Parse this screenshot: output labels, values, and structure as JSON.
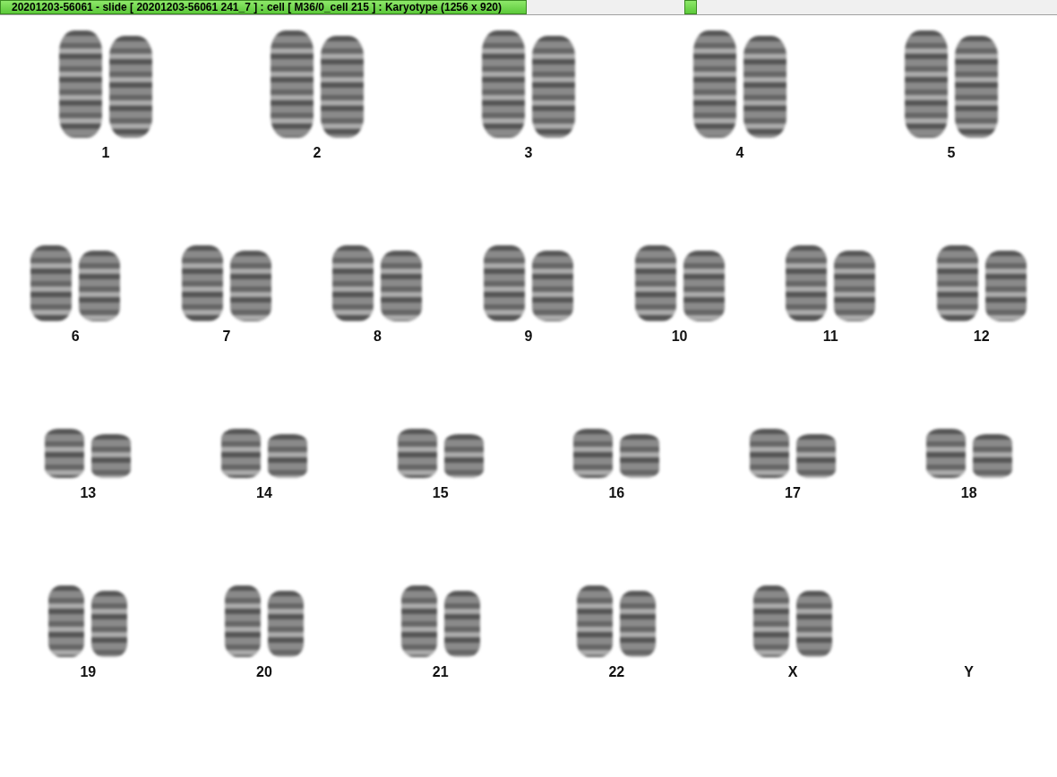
{
  "window": {
    "title": "20201203-56061 - slide [ 20201203-56061 241_7 ] : cell [ M36/0_cell 215 ] : Karyotype  (1256 x 920)"
  },
  "rows": [
    {
      "pairs": [
        {
          "label": "1",
          "kind": "pair"
        },
        {
          "label": "2",
          "kind": "pair"
        },
        {
          "label": "3",
          "kind": "pair"
        },
        {
          "label": "4",
          "kind": "pair"
        },
        {
          "label": "5",
          "kind": "pair"
        }
      ]
    },
    {
      "pairs": [
        {
          "label": "6",
          "kind": "pair"
        },
        {
          "label": "7",
          "kind": "pair"
        },
        {
          "label": "8",
          "kind": "pair"
        },
        {
          "label": "9",
          "kind": "pair"
        },
        {
          "label": "10",
          "kind": "pair"
        },
        {
          "label": "11",
          "kind": "pair"
        },
        {
          "label": "12",
          "kind": "pair"
        }
      ]
    },
    {
      "pairs": [
        {
          "label": "13",
          "kind": "pair"
        },
        {
          "label": "14",
          "kind": "pair"
        },
        {
          "label": "15",
          "kind": "pair"
        },
        {
          "label": "16",
          "kind": "pair"
        },
        {
          "label": "17",
          "kind": "pair"
        },
        {
          "label": "18",
          "kind": "pair"
        }
      ]
    },
    {
      "pairs": [
        {
          "label": "19",
          "kind": "pair"
        },
        {
          "label": "20",
          "kind": "pair"
        },
        {
          "label": "21",
          "kind": "pair"
        },
        {
          "label": "22",
          "kind": "pair"
        },
        {
          "label": "X",
          "kind": "pair"
        },
        {
          "label": "Y",
          "kind": "empty"
        }
      ]
    }
  ]
}
